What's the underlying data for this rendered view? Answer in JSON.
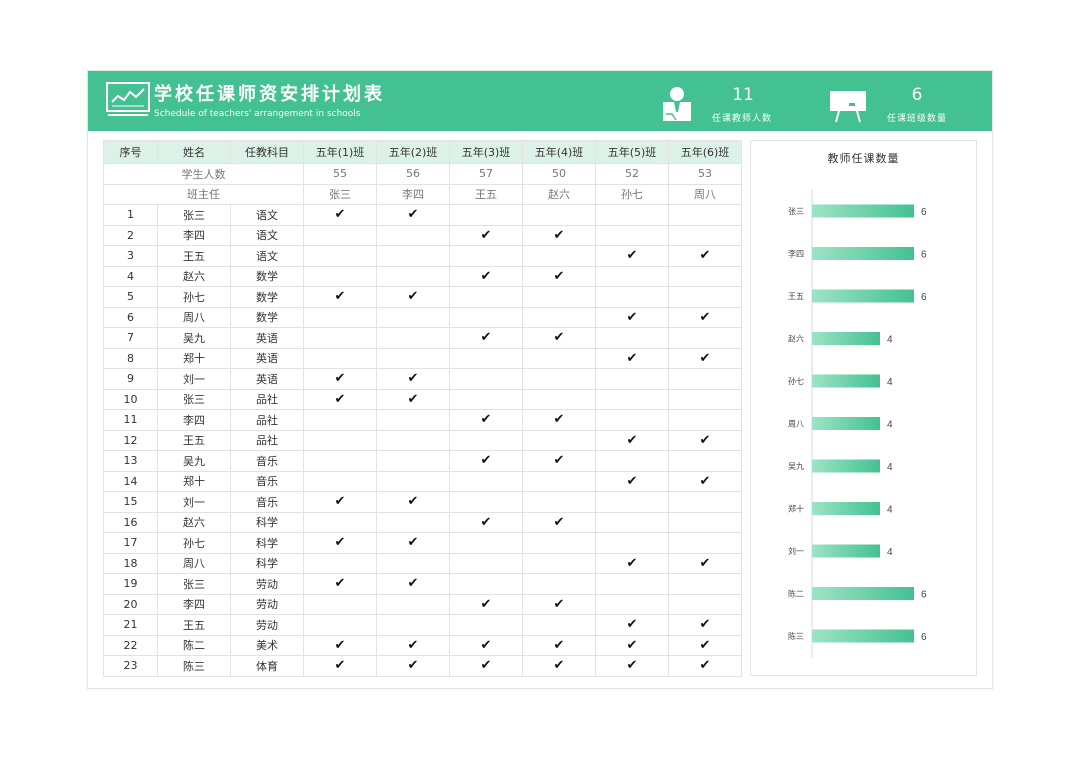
{
  "header": {
    "title": "学校任课师资安排计划表",
    "subtitle": "Schedule of teachers' arrangement in schools",
    "stats": [
      {
        "value": "11",
        "label": "任课教师人数",
        "icon": "teacher-icon"
      },
      {
        "value": "6",
        "label": "任课班级数量",
        "icon": "blackboard-icon"
      }
    ]
  },
  "colors": {
    "accent": "#43c192",
    "header_fill": "#dcf2e8",
    "bar": "#43c192"
  },
  "table": {
    "headers": [
      "序号",
      "姓名",
      "任教科目",
      "五年(1)班",
      "五年(2)班",
      "五年(3)班",
      "五年(4)班",
      "五年(5)班",
      "五年(6)班"
    ],
    "students_label": "学生人数",
    "students": [
      "55",
      "56",
      "57",
      "50",
      "52",
      "53"
    ],
    "homeroom_label": "班主任",
    "homeroom": [
      "张三",
      "李四",
      "王五",
      "赵六",
      "孙七",
      "周八"
    ],
    "check_mark": "✔",
    "rows": [
      {
        "no": "1",
        "name": "张三",
        "subject": "语文",
        "classes": [
          1,
          1,
          0,
          0,
          0,
          0
        ]
      },
      {
        "no": "2",
        "name": "李四",
        "subject": "语文",
        "classes": [
          0,
          0,
          1,
          1,
          0,
          0
        ]
      },
      {
        "no": "3",
        "name": "王五",
        "subject": "语文",
        "classes": [
          0,
          0,
          0,
          0,
          1,
          1
        ]
      },
      {
        "no": "4",
        "name": "赵六",
        "subject": "数学",
        "classes": [
          0,
          0,
          1,
          1,
          0,
          0
        ]
      },
      {
        "no": "5",
        "name": "孙七",
        "subject": "数学",
        "classes": [
          1,
          1,
          0,
          0,
          0,
          0
        ]
      },
      {
        "no": "6",
        "name": "周八",
        "subject": "数学",
        "classes": [
          0,
          0,
          0,
          0,
          1,
          1
        ]
      },
      {
        "no": "7",
        "name": "吴九",
        "subject": "英语",
        "classes": [
          0,
          0,
          1,
          1,
          0,
          0
        ]
      },
      {
        "no": "8",
        "name": "郑十",
        "subject": "英语",
        "classes": [
          0,
          0,
          0,
          0,
          1,
          1
        ]
      },
      {
        "no": "9",
        "name": "刘一",
        "subject": "英语",
        "classes": [
          1,
          1,
          0,
          0,
          0,
          0
        ]
      },
      {
        "no": "10",
        "name": "张三",
        "subject": "品社",
        "classes": [
          1,
          1,
          0,
          0,
          0,
          0
        ]
      },
      {
        "no": "11",
        "name": "李四",
        "subject": "品社",
        "classes": [
          0,
          0,
          1,
          1,
          0,
          0
        ]
      },
      {
        "no": "12",
        "name": "王五",
        "subject": "品社",
        "classes": [
          0,
          0,
          0,
          0,
          1,
          1
        ]
      },
      {
        "no": "13",
        "name": "吴九",
        "subject": "音乐",
        "classes": [
          0,
          0,
          1,
          1,
          0,
          0
        ]
      },
      {
        "no": "14",
        "name": "郑十",
        "subject": "音乐",
        "classes": [
          0,
          0,
          0,
          0,
          1,
          1
        ]
      },
      {
        "no": "15",
        "name": "刘一",
        "subject": "音乐",
        "classes": [
          1,
          1,
          0,
          0,
          0,
          0
        ]
      },
      {
        "no": "16",
        "name": "赵六",
        "subject": "科学",
        "classes": [
          0,
          0,
          1,
          1,
          0,
          0
        ]
      },
      {
        "no": "17",
        "name": "孙七",
        "subject": "科学",
        "classes": [
          1,
          1,
          0,
          0,
          0,
          0
        ]
      },
      {
        "no": "18",
        "name": "周八",
        "subject": "科学",
        "classes": [
          0,
          0,
          0,
          0,
          1,
          1
        ]
      },
      {
        "no": "19",
        "name": "张三",
        "subject": "劳动",
        "classes": [
          1,
          1,
          0,
          0,
          0,
          0
        ]
      },
      {
        "no": "20",
        "name": "李四",
        "subject": "劳动",
        "classes": [
          0,
          0,
          1,
          1,
          0,
          0
        ]
      },
      {
        "no": "21",
        "name": "王五",
        "subject": "劳动",
        "classes": [
          0,
          0,
          0,
          0,
          1,
          1
        ]
      },
      {
        "no": "22",
        "name": "陈二",
        "subject": "美术",
        "classes": [
          1,
          1,
          1,
          1,
          1,
          1
        ]
      },
      {
        "no": "23",
        "name": "陈三",
        "subject": "体育",
        "classes": [
          1,
          1,
          1,
          1,
          1,
          1
        ]
      }
    ]
  },
  "chart_data": {
    "type": "bar",
    "orientation": "horizontal",
    "title": "教师任课数量",
    "categories": [
      "张三",
      "李四",
      "王五",
      "赵六",
      "孙七",
      "周八",
      "吴九",
      "郑十",
      "刘一",
      "陈二",
      "陈三"
    ],
    "values": [
      6,
      6,
      6,
      4,
      4,
      4,
      4,
      4,
      4,
      6,
      6
    ],
    "xlim": [
      0,
      10
    ],
    "grid": false,
    "legend": "none"
  }
}
